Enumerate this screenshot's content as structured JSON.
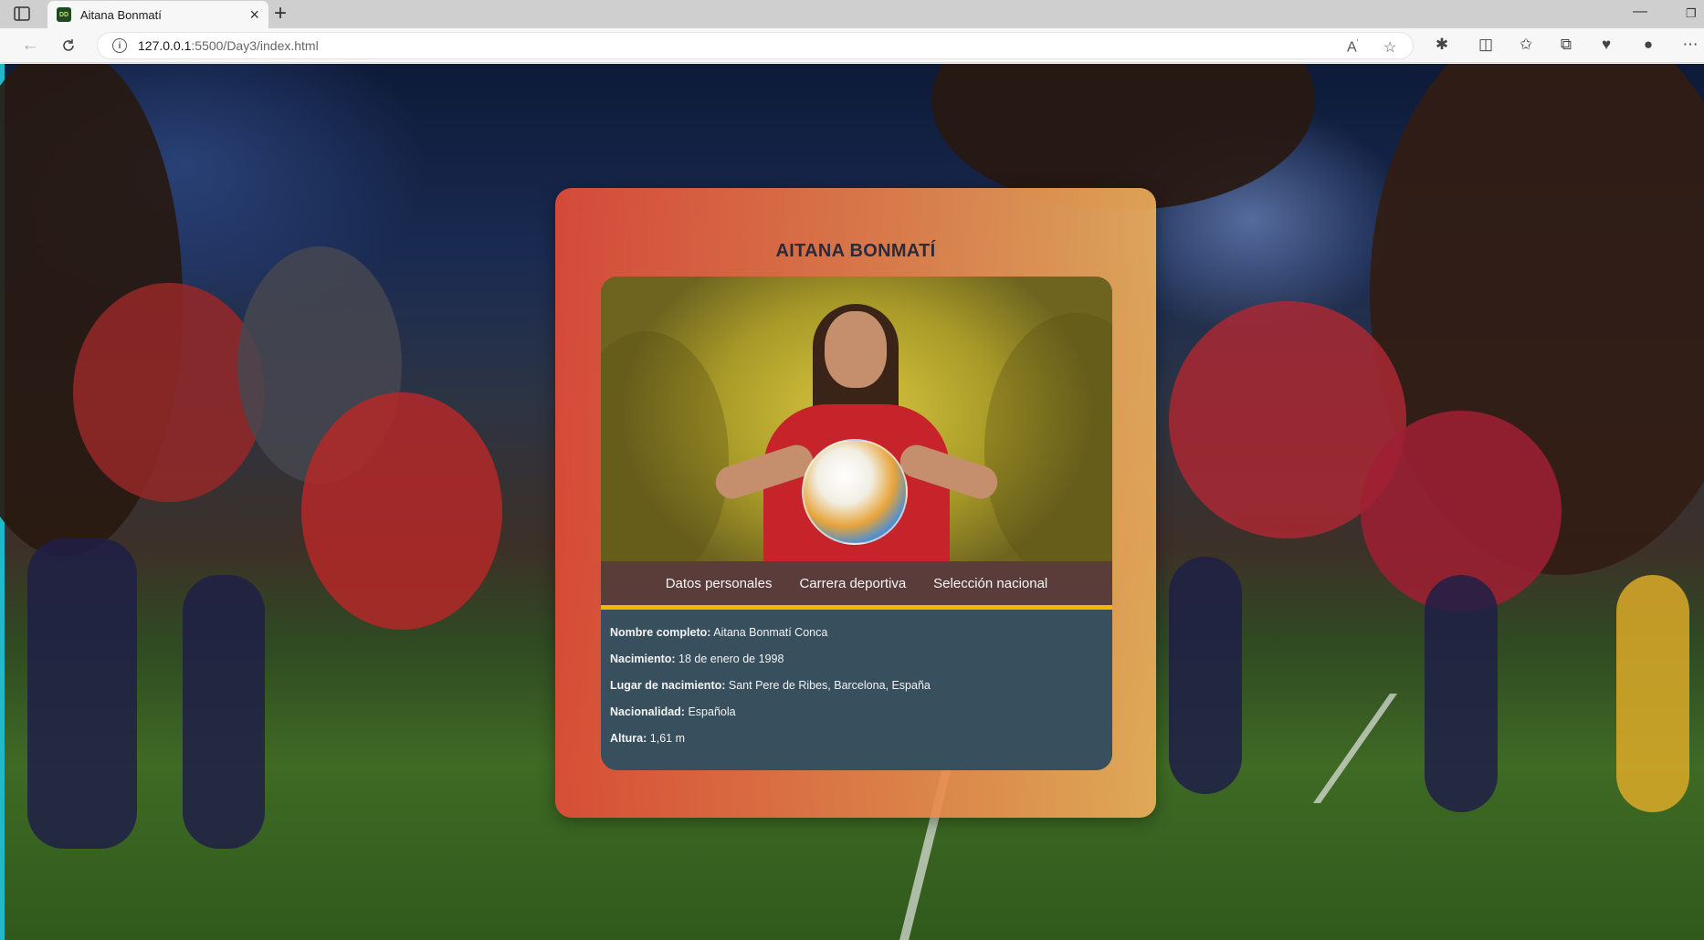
{
  "browser": {
    "tab_title": "Aitana Bonmatí",
    "favicon_text": "DD",
    "url_host": "127.0.0.1",
    "url_path": ":5500/Day3/index.html"
  },
  "card": {
    "title": "AITANA BONMATÍ",
    "tabs": [
      "Datos personales",
      "Carrera deportiva",
      "Selección nacional"
    ],
    "active_tab": "Datos personales",
    "fields": [
      {
        "label": "Nombre completo:",
        "value": "Aitana Bonmatí Conca"
      },
      {
        "label": "Nacimiento:",
        "value": "18 de enero de 1998"
      },
      {
        "label": "Lugar de nacimiento:",
        "value": "Sant Pere de Ribes, Barcelona, España"
      },
      {
        "label": "Nacionalidad:",
        "value": "Española"
      },
      {
        "label": "Altura:",
        "value": "1,61 m"
      }
    ]
  },
  "colors": {
    "accent_line": "#f2b600",
    "card_gradient_start": "#e24c38",
    "card_gradient_end": "#f0b05c",
    "content_bg": "#384f5e"
  },
  "icons": [
    "sidebar-toggle-icon",
    "close-icon",
    "plus-icon",
    "back-arrow-icon",
    "refresh-icon",
    "info-icon",
    "read-aloud-icon",
    "star-icon",
    "extensions-icon",
    "split-screen-icon",
    "favorites-icon",
    "collections-icon",
    "performance-icon",
    "profile-icon",
    "more-icon"
  ]
}
